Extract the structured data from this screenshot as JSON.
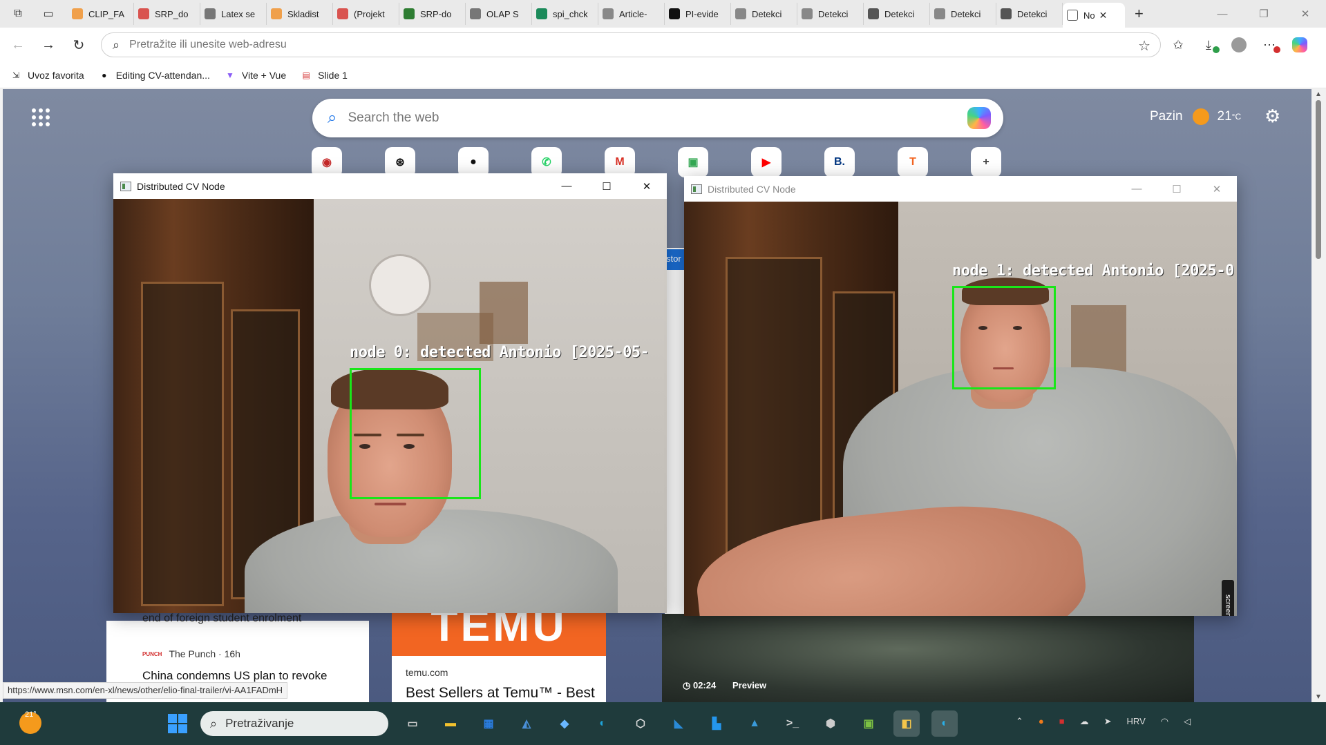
{
  "browser": {
    "tabs": [
      {
        "title": "CLIP_FA",
        "icon": "infinity-icon",
        "color": "#f0a04b"
      },
      {
        "title": "SRP_do",
        "icon": "pdf-icon",
        "color": "#d9534f"
      },
      {
        "title": "Latex se",
        "icon": "gear-icon",
        "color": "#777777"
      },
      {
        "title": "Skladist",
        "icon": "infinity-icon",
        "color": "#f0a04b"
      },
      {
        "title": "(Projekt",
        "icon": "pdf-icon",
        "color": "#d9534f"
      },
      {
        "title": "SRP-do",
        "icon": "link-icon",
        "color": "#2e7d32"
      },
      {
        "title": "OLAP S",
        "icon": "gear-icon",
        "color": "#777777"
      },
      {
        "title": "spi_chck",
        "icon": "v-icon",
        "color": "#1b8a5a"
      },
      {
        "title": "Article-",
        "icon": "link-icon",
        "color": "#888888"
      },
      {
        "title": "PI-evide",
        "icon": "github-icon",
        "color": "#111111"
      },
      {
        "title": "Detekci",
        "icon": "globe-icon",
        "color": "#888888"
      },
      {
        "title": "Detekci",
        "icon": "globe-icon",
        "color": "#888888"
      },
      {
        "title": "Detekci",
        "icon": "globe-icon",
        "color": "#555555"
      },
      {
        "title": "Detekci",
        "icon": "globe-icon",
        "color": "#888888"
      },
      {
        "title": "Detekci",
        "icon": "globe-icon",
        "color": "#555555"
      }
    ],
    "active_tab": {
      "title": "No",
      "icon": "page-icon"
    },
    "address_placeholder": "Pretražite ili unesite web-adresu",
    "favorites": [
      {
        "label": "Uvoz favorita",
        "icon": "import-icon"
      },
      {
        "label": "Editing CV-attendan...",
        "icon": "github-icon"
      },
      {
        "label": "Vite + Vue",
        "icon": "vite-icon"
      },
      {
        "label": "Slide 1",
        "icon": "pdf-icon"
      }
    ]
  },
  "ntp": {
    "search_placeholder": "Search the web",
    "weather": {
      "city": "Pazin",
      "temp": "21",
      "unit": "°C"
    },
    "quick_links": [
      {
        "name": "record-icon",
        "glyph": "◉",
        "color": "#c62828"
      },
      {
        "name": "openai-icon",
        "glyph": "⊛",
        "color": "#111111"
      },
      {
        "name": "github-icon",
        "glyph": "●",
        "color": "#111111"
      },
      {
        "name": "whatsapp-icon",
        "glyph": "✆",
        "color": "#25d366"
      },
      {
        "name": "gmail-icon",
        "glyph": "M",
        "color": "#d93025"
      },
      {
        "name": "chat-icon",
        "glyph": "▣",
        "color": "#34a853"
      },
      {
        "name": "youtube-icon",
        "glyph": "▶",
        "color": "#ff0000"
      },
      {
        "name": "booking-icon",
        "glyph": "B.",
        "color": "#003580"
      },
      {
        "name": "temu-icon",
        "glyph": "T",
        "color": "#f26522"
      },
      {
        "name": "add-icon",
        "glyph": "+",
        "color": "#444444"
      }
    ],
    "story_chip": "stor",
    "news": {
      "headline_1": "end of foreign student enrolment",
      "source": "The Punch · 16h",
      "headline_2": "China condemns US plan to revoke student visas"
    },
    "temu": {
      "banner": "TEMU",
      "domain": "temu.com",
      "headline": "Best Sellers at Temu™ - Best"
    },
    "video": {
      "duration": "02:24",
      "badge": "Preview"
    },
    "status_url": "https://www.msn.com/en-xl/news/other/elio-final-trailer/vi-AA1FADmH"
  },
  "cv_windows": [
    {
      "title": "Distributed CV Node",
      "label": "node 0: detected Antonio [2025-05-",
      "state": "active"
    },
    {
      "title": "Distributed CV Node",
      "label": "node 1: detected Antonio [2025-0",
      "state": "inactive"
    }
  ],
  "recorder_tag": "screenrec",
  "taskbar": {
    "weather_temp": "21°",
    "search_placeholder": "Pretraživanje",
    "apps": [
      {
        "name": "task-view-icon",
        "glyph": "▭",
        "color": "#cccccc"
      },
      {
        "name": "file-explorer-icon",
        "glyph": "▬",
        "color": "#f2c12e"
      },
      {
        "name": "microsoft-store-icon",
        "glyph": "▦",
        "color": "#2a7de1"
      },
      {
        "name": "ssms-icon",
        "glyph": "◭",
        "color": "#4a90d9"
      },
      {
        "name": "devhome-icon",
        "glyph": "◆",
        "color": "#6ab7ff"
      },
      {
        "name": "edge-icon",
        "glyph": "◐",
        "color": "#1fa3d8"
      },
      {
        "name": "unity-icon",
        "glyph": "⬡",
        "color": "#dddddd"
      },
      {
        "name": "vscode-icon",
        "glyph": "◣",
        "color": "#2a8ad6"
      },
      {
        "name": "docker-icon",
        "glyph": "▙",
        "color": "#2496ed"
      },
      {
        "name": "azure-data-icon",
        "glyph": "▲",
        "color": "#3a9ad9"
      },
      {
        "name": "terminal-icon",
        "glyph": ">_",
        "color": "#dddddd"
      },
      {
        "name": "package-icon",
        "glyph": "⬢",
        "color": "#cccccc"
      },
      {
        "name": "android-icon",
        "glyph": "▣",
        "color": "#7cc043"
      },
      {
        "name": "python-icon",
        "glyph": "◧",
        "color": "#f4c64b"
      },
      {
        "name": "edge-active-icon",
        "glyph": "◐",
        "color": "#2ab0e8"
      }
    ],
    "tray_language": "HRV"
  }
}
